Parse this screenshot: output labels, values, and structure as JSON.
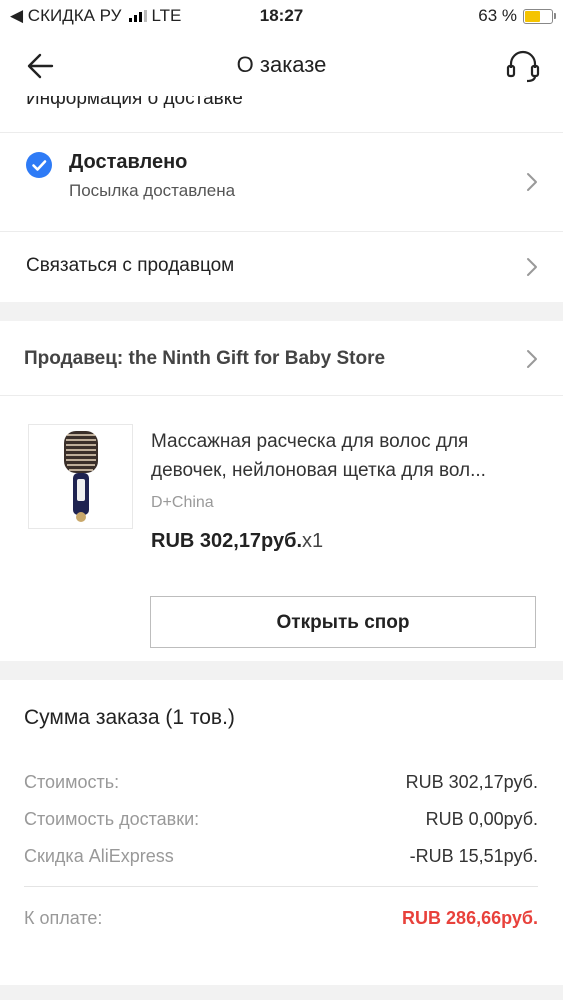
{
  "status_bar": {
    "back_label": "◀ СКИДКА РУ",
    "network": "LTE",
    "time": "18:27",
    "battery_percent": "63 %",
    "battery_level": 0.63,
    "battery_color": "#f5c400"
  },
  "header": {
    "title": "О заказе",
    "back_icon": "arrow-left-icon",
    "support_icon": "headset-icon"
  },
  "delivery": {
    "section_heading": "Информация о доставке",
    "status_title": "Доставлено",
    "status_subtitle": "Посылка доставлена",
    "status_icon": "check-circle-icon",
    "status_color": "#2e7bf6"
  },
  "contact_seller": {
    "label": "Связаться с продавцом"
  },
  "seller": {
    "label": "Продавец: the Ninth Gift for Baby Store"
  },
  "product": {
    "name_line1": "Массажная расческа для волос для",
    "name_line2": "девочек, нейлоновая щетка для вол...",
    "variant": "D+China",
    "price": "RUB 302,17руб.",
    "quantity": "x1",
    "image_icon": "hair-brush-image"
  },
  "dispute_button": {
    "label": "Открыть спор"
  },
  "summary": {
    "title": "Сумма заказа (1 тов.)",
    "lines": [
      {
        "label": "Стоимость:",
        "value": "RUB 302,17руб."
      },
      {
        "label": "Стоимость доставки:",
        "value": "RUB 0,00руб."
      },
      {
        "label": "Скидка AliExpress",
        "value": "-RUB 15,51руб."
      }
    ],
    "total_label": "К оплате:",
    "total_value": "RUB 286,66руб.",
    "total_color": "#e8413b"
  }
}
